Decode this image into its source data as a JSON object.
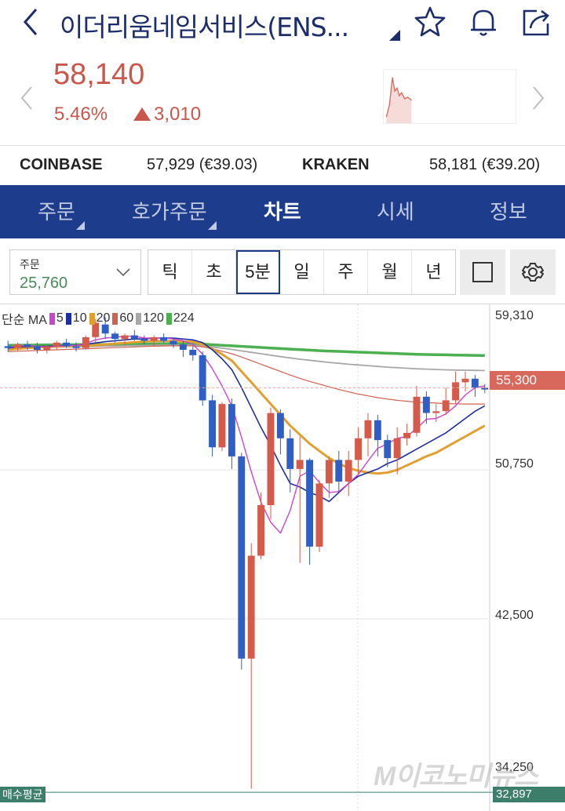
{
  "header": {
    "title": "이더리움네임서비스(ENS...",
    "icons": [
      "chevron-left-icon",
      "star-icon",
      "bell-icon",
      "share-icon"
    ]
  },
  "quote": {
    "price": "58,140",
    "change_pct": "5.46%",
    "change_abs": "3,010",
    "color_up": "#c9574b"
  },
  "exchanges": [
    {
      "name": "COINBASE",
      "value": "57,929 (€39.03)"
    },
    {
      "name": "KRAKEN",
      "value": "58,181 (€39.20)"
    }
  ],
  "tabs": [
    {
      "label": "주문",
      "active": false
    },
    {
      "label": "호가주문",
      "active": false
    },
    {
      "label": "차트",
      "active": true
    },
    {
      "label": "시세",
      "active": false
    },
    {
      "label": "정보",
      "active": false
    }
  ],
  "toolbar": {
    "order_label": "주문",
    "order_value": "25,760",
    "periods": [
      "틱",
      "초",
      "5분",
      "일",
      "주",
      "월",
      "년"
    ],
    "active_period": "5분"
  },
  "chart_data": {
    "type": "candlestick",
    "legend_prefix": "단순 MA",
    "ma_series": [
      {
        "name": "5",
        "color": "#cc44cc"
      },
      {
        "name": "10",
        "color": "#1f2fa0"
      },
      {
        "name": "20",
        "color": "#e0a030"
      },
      {
        "name": "60",
        "color": "#d06050"
      },
      {
        "name": "120",
        "color": "#a8a8a8"
      },
      {
        "name": "224",
        "color": "#4caf50"
      }
    ],
    "y_ticks": [
      "59,310",
      "50,750",
      "42,500",
      "34,250"
    ],
    "ylim": [
      32500,
      59800
    ],
    "current_price_label": "55,300",
    "avg_buy_label": "매수평균",
    "avg_buy_value": "32,897",
    "candles": [
      [
        57600,
        57900,
        57300,
        57500
      ],
      [
        57500,
        57800,
        57300,
        57700
      ],
      [
        57700,
        57900,
        57400,
        57600
      ],
      [
        57600,
        57800,
        57200,
        57400
      ],
      [
        57400,
        57700,
        57200,
        57600
      ],
      [
        57600,
        57900,
        57400,
        57800
      ],
      [
        57800,
        58000,
        57500,
        57600
      ],
      [
        57600,
        57800,
        57300,
        57500
      ],
      [
        57500,
        58200,
        57400,
        58100
      ],
      [
        58100,
        59100,
        57800,
        58900
      ],
      [
        58800,
        59200,
        58000,
        58300
      ],
      [
        58300,
        58400,
        57800,
        58000
      ],
      [
        58000,
        58300,
        57600,
        58200
      ],
      [
        58200,
        58500,
        57900,
        58000
      ],
      [
        58000,
        58200,
        57700,
        57900
      ],
      [
        57900,
        58200,
        57600,
        58100
      ],
      [
        58100,
        58300,
        57800,
        57900
      ],
      [
        57900,
        58000,
        57500,
        57700
      ],
      [
        57700,
        57900,
        57000,
        57400
      ],
      [
        57400,
        57600,
        56800,
        57100
      ],
      [
        57100,
        57300,
        54300,
        54600
      ],
      [
        54600,
        54900,
        51500,
        52000
      ],
      [
        52000,
        54500,
        51800,
        54400
      ],
      [
        54400,
        54700,
        50800,
        51500
      ],
      [
        51500,
        51700,
        39700,
        40300
      ],
      [
        40300,
        46700,
        33100,
        46000
      ],
      [
        46000,
        49500,
        45800,
        48800
      ],
      [
        48800,
        54200,
        48000,
        53900
      ],
      [
        53900,
        54100,
        51600,
        52500
      ],
      [
        52500,
        53000,
        49500,
        50800
      ],
      [
        50800,
        52600,
        45600,
        51300
      ],
      [
        51300,
        51400,
        45500,
        46500
      ],
      [
        46500,
        50200,
        46200,
        50000
      ],
      [
        50000,
        51500,
        49200,
        51300
      ],
      [
        51300,
        51800,
        49500,
        50100
      ],
      [
        50100,
        51800,
        49300,
        51300
      ],
      [
        51300,
        53100,
        50500,
        52500
      ],
      [
        52500,
        53900,
        51500,
        53500
      ],
      [
        53500,
        53800,
        51500,
        52400
      ],
      [
        52400,
        52700,
        50900,
        51400
      ],
      [
        51400,
        53100,
        50500,
        52500
      ],
      [
        52500,
        53300,
        52100,
        52800
      ],
      [
        52800,
        55400,
        52600,
        54800
      ],
      [
        54800,
        55100,
        53300,
        53900
      ],
      [
        53900,
        54400,
        53400,
        54000
      ],
      [
        54000,
        55300,
        53800,
        54600
      ],
      [
        54600,
        56200,
        54400,
        55600
      ],
      [
        55600,
        56200,
        55100,
        55800
      ],
      [
        55800,
        56000,
        54800,
        55300
      ],
      [
        55300,
        55500,
        55000,
        55200
      ]
    ],
    "ma5": [
      57550,
      57600,
      57620,
      57600,
      57550,
      57600,
      57620,
      57650,
      57750,
      57950,
      58050,
      58100,
      58150,
      58150,
      58050,
      58050,
      58050,
      58000,
      57900,
      57700,
      57150,
      56350,
      55400,
      54300,
      52550,
      50650,
      48950,
      47850,
      47250,
      48500,
      50400,
      50700,
      50050,
      49500,
      49550,
      50000,
      50500,
      51250,
      51950,
      52200,
      52500,
      52600,
      53050,
      53550,
      53600,
      53850,
      54300,
      54900,
      55300,
      55400
    ],
    "ma10": [
      57500,
      57550,
      57580,
      57590,
      57600,
      57620,
      57640,
      57660,
      57700,
      57780,
      57850,
      57900,
      57950,
      58000,
      58000,
      58050,
      58050,
      58050,
      58000,
      57950,
      57800,
      57400,
      56900,
      56300,
      55300,
      54200,
      53100,
      52100,
      51000,
      50000,
      49800,
      49500,
      49300,
      49000,
      49500,
      50000,
      50400,
      50600,
      50800,
      51100,
      51300,
      51600,
      51900,
      52200,
      52500,
      52800,
      53200,
      53600,
      54000,
      54300
    ],
    "ma20": [
      57400,
      57450,
      57500,
      57530,
      57560,
      57580,
      57600,
      57620,
      57640,
      57660,
      57700,
      57740,
      57780,
      57820,
      57860,
      57880,
      57880,
      57880,
      57860,
      57840,
      57700,
      57450,
      57150,
      56800,
      56200,
      55600,
      55000,
      54400,
      53800,
      53200,
      52700,
      52200,
      51800,
      51400,
      51100,
      50850,
      50700,
      50600,
      50550,
      50600,
      50750,
      51000,
      51250,
      51500,
      51700,
      52000,
      52300,
      52600,
      52900,
      53200
    ],
    "ma60": [
      57300,
      57320,
      57340,
      57360,
      57380,
      57400,
      57420,
      57440,
      57460,
      57480,
      57500,
      57520,
      57540,
      57560,
      57580,
      57600,
      57610,
      57620,
      57620,
      57620,
      57560,
      57450,
      57320,
      57180,
      57000,
      56800,
      56600,
      56400,
      56200,
      56000,
      55820,
      55650,
      55500,
      55350,
      55200,
      55070,
      54950,
      54850,
      54750,
      54670,
      54600,
      54550,
      54500,
      54470,
      54450,
      54420,
      54410,
      54400,
      54400,
      54400
    ],
    "ma120": [
      57500,
      57510,
      57520,
      57530,
      57540,
      57550,
      57560,
      57570,
      57580,
      57590,
      57600,
      57610,
      57620,
      57630,
      57640,
      57650,
      57655,
      57660,
      57660,
      57660,
      57620,
      57560,
      57490,
      57420,
      57340,
      57260,
      57180,
      57100,
      57020,
      56950,
      56880,
      56820,
      56760,
      56700,
      56650,
      56600,
      56560,
      56520,
      56480,
      56440,
      56410,
      56380,
      56350,
      56330,
      56310,
      56290,
      56280,
      56270,
      56260,
      56250
    ],
    "ma224": [
      57650,
      57655,
      57660,
      57665,
      57670,
      57675,
      57680,
      57685,
      57690,
      57695,
      57700,
      57705,
      57710,
      57715,
      57720,
      57725,
      57728,
      57730,
      57730,
      57730,
      57710,
      57680,
      57650,
      57620,
      57590,
      57560,
      57530,
      57500,
      57470,
      57440,
      57410,
      57380,
      57350,
      57330,
      57310,
      57290,
      57270,
      57250,
      57230,
      57210,
      57190,
      57170,
      57150,
      57140,
      57130,
      57120,
      57110,
      57100,
      57090,
      57080
    ]
  },
  "watermark": "M이코노미뉴스"
}
